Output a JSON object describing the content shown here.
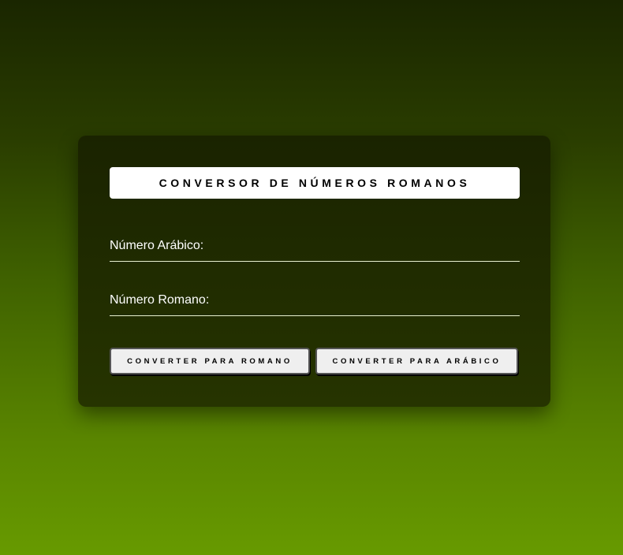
{
  "title": "CONVERSOR DE NÚMEROS ROMANOS",
  "fields": {
    "arabic_label": "Número Arábico:",
    "roman_label": "Número Romano:"
  },
  "buttons": {
    "to_roman": "CONVERTER PARA ROMANO",
    "to_arabic": "CONVERTER PARA ARÁBICO"
  }
}
